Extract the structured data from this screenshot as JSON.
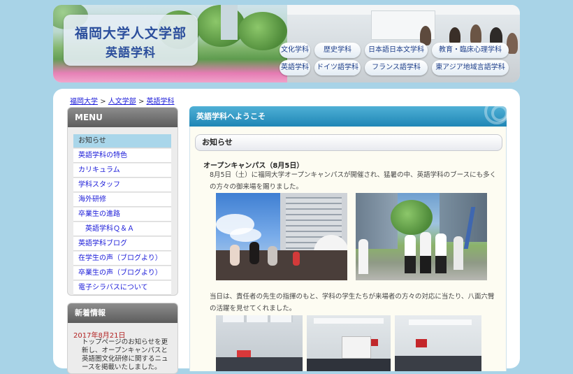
{
  "header": {
    "title_line1": "福岡大学人文学部",
    "title_line2": "英語学科",
    "nav_row1": [
      "文化学科",
      "歴史学科",
      "日本語日本文学科",
      "教育・臨床心理学科"
    ],
    "nav_row2": [
      "英語学科",
      "ドイツ語学科",
      "フランス語学科",
      "東アジア地域言語学科"
    ]
  },
  "breadcrumb": {
    "items": [
      "福岡大学",
      "人文学部",
      "英語学科"
    ],
    "separator": ">"
  },
  "sidebar": {
    "menu_title": "MENU",
    "items": [
      "お知らせ",
      "英語学科の特色",
      "カリキュラム",
      "学科スタッフ",
      "海外研修",
      "卒業生の進路",
      "英語学科Ｑ＆Ａ",
      "英語学科ブログ",
      "在学生の声（ブログより）",
      "卒業生の声（ブログより）",
      "電子シラバスについて"
    ],
    "active_index": 0,
    "sub_index": 6,
    "news_title": "新着情報",
    "news_date": "2017年8月21日",
    "news_text": "トップページのお知らせを更新し、オープンキャンパスと英語圏文化研修に関するニュースを掲載いたしました。"
  },
  "content": {
    "title": "英語学科へようこそ",
    "section": "お知らせ",
    "article_heading": "オープンキャンパス（8月5日）",
    "paragraph1": "8月5日（土）に福岡大学オープンキャンパスが開催され、猛暑の中、英語学科のブースにも多くの方々の御来場を賜りました。",
    "paragraph2": "当日は、責任者の先生の指揮のもと、学科の学生たちが来場者の方々の対応に当たり、八面六臂の活躍を見せてくれました。"
  },
  "colors": {
    "background": "#a8d3e7",
    "accent": "#1f86b5",
    "link": "#1a1ad8",
    "logo_text": "#2b4e9c",
    "news_date": "#b22222",
    "active_menu": "#a9d6ea"
  }
}
